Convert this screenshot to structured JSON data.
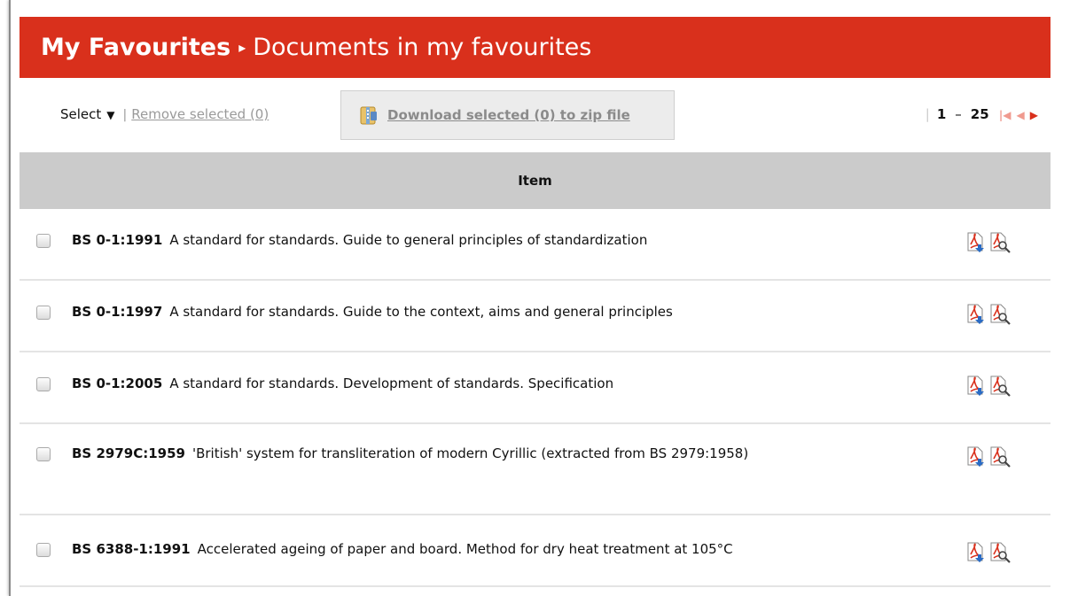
{
  "header": {
    "crumb_parent": "My Favourites",
    "separator": "▸",
    "crumb_current": "Documents in my favourites"
  },
  "toolbar": {
    "select_label": "Select",
    "select_caret": "▼",
    "divider": "|",
    "remove_label": "Remove selected (0)",
    "download_label": "Download selected (0) to zip file"
  },
  "pager": {
    "divider": "|",
    "start": "1",
    "dash": "–",
    "end": "25",
    "first_icon": "first-page-icon",
    "prev_icon": "prev-page-icon",
    "next_icon": "next-page-icon"
  },
  "table": {
    "column_header": "Item",
    "rows": [
      {
        "code": "BS 0-1:1991",
        "title": "A standard for standards. Guide to general principles of standardization"
      },
      {
        "code": "BS 0-1:1997",
        "title": "A standard for standards. Guide to the context, aims and general principles"
      },
      {
        "code": "BS 0-1:2005",
        "title": "A standard for standards. Development of standards. Specification"
      },
      {
        "code": "BS 2979C:1959",
        "title": "'British' system for transliteration of modern Cyrillic (extracted from BS 2979:1958)"
      },
      {
        "code": "BS 6388-1:1991",
        "title": "Accelerated ageing of paper and board. Method for dry heat treatment at 105°C"
      }
    ],
    "row_icons": [
      "pdf-download-icon",
      "pdf-preview-icon"
    ]
  },
  "colors": {
    "brand_red": "#d9301c",
    "table_header_bg": "#cbcbcb",
    "disabled_text": "#9a9a9a"
  }
}
